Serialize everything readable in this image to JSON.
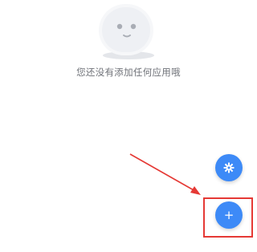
{
  "empty_state": {
    "message": "您还没有添加任何应用哦"
  },
  "fabs": {
    "settings_icon": "gear-icon",
    "add_label": "+"
  },
  "colors": {
    "accent": "#3d8af7",
    "annotation": "#e53935",
    "text_muted": "#6f7278"
  }
}
